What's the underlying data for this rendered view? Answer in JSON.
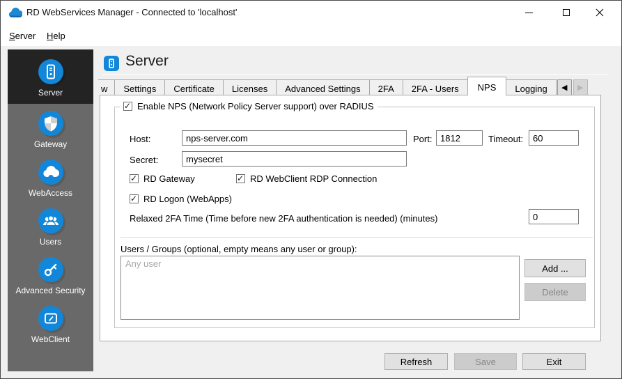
{
  "window": {
    "title": "RD WebServices Manager - Connected to 'localhost'"
  },
  "menu": {
    "items": [
      {
        "key": "S",
        "rest": "erver"
      },
      {
        "key": "H",
        "rest": "elp"
      }
    ]
  },
  "sidebar": {
    "active": "Server",
    "items": [
      {
        "label": "Server",
        "icon": "server-icon"
      },
      {
        "label": "Gateway",
        "icon": "shield-icon"
      },
      {
        "label": "WebAccess",
        "icon": "cloud-icon"
      },
      {
        "label": "Users",
        "icon": "users-icon"
      },
      {
        "label": "Advanced Security",
        "icon": "key-icon"
      },
      {
        "label": "WebClient",
        "icon": "screen-icon"
      }
    ]
  },
  "header": {
    "title": "Server"
  },
  "tabs": {
    "items": [
      {
        "label": "w"
      },
      {
        "label": "Settings"
      },
      {
        "label": "Certificate"
      },
      {
        "label": "Licenses"
      },
      {
        "label": "Advanced Settings"
      },
      {
        "label": "2FA"
      },
      {
        "label": "2FA - Users"
      },
      {
        "label": "NPS"
      },
      {
        "label": "Logging"
      }
    ],
    "active": "NPS",
    "left_arrow": "◀",
    "right_arrow": "▶",
    "right_arrow_enabled": false
  },
  "nps": {
    "enable": {
      "label": "Enable NPS (Network Policy Server support) over RADIUS",
      "checked": true
    },
    "host": {
      "label": "Host:",
      "value": "nps-server.com"
    },
    "port": {
      "label": "Port:",
      "value": "1812"
    },
    "timeout": {
      "label": "Timeout:",
      "value": "60"
    },
    "secret": {
      "label": "Secret:",
      "value": "mysecret"
    },
    "rd_gateway": {
      "label": "RD Gateway",
      "checked": true
    },
    "rd_webclient_rdp": {
      "label": "RD WebClient RDP Connection",
      "checked": true
    },
    "rd_logon": {
      "label": "RD Logon (WebApps)",
      "checked": true
    },
    "relaxed_2fa": {
      "label": "Relaxed 2FA Time (Time before new 2FA authentication is needed) (minutes)",
      "value": "0"
    },
    "users_groups": {
      "label": "Users / Groups (optional, empty means any user or group):",
      "placeholder": "Any user"
    },
    "buttons": {
      "add": "Add ...",
      "delete": "Delete",
      "delete_enabled": false
    }
  },
  "footer": {
    "refresh": "Refresh",
    "save": "Save",
    "save_enabled": false,
    "exit": "Exit"
  },
  "colors": {
    "accent_blue": "#1287d9",
    "sidebar_bg": "#696969",
    "sidebar_active_bg": "#232323",
    "window_bg": "#f0f0f0"
  }
}
